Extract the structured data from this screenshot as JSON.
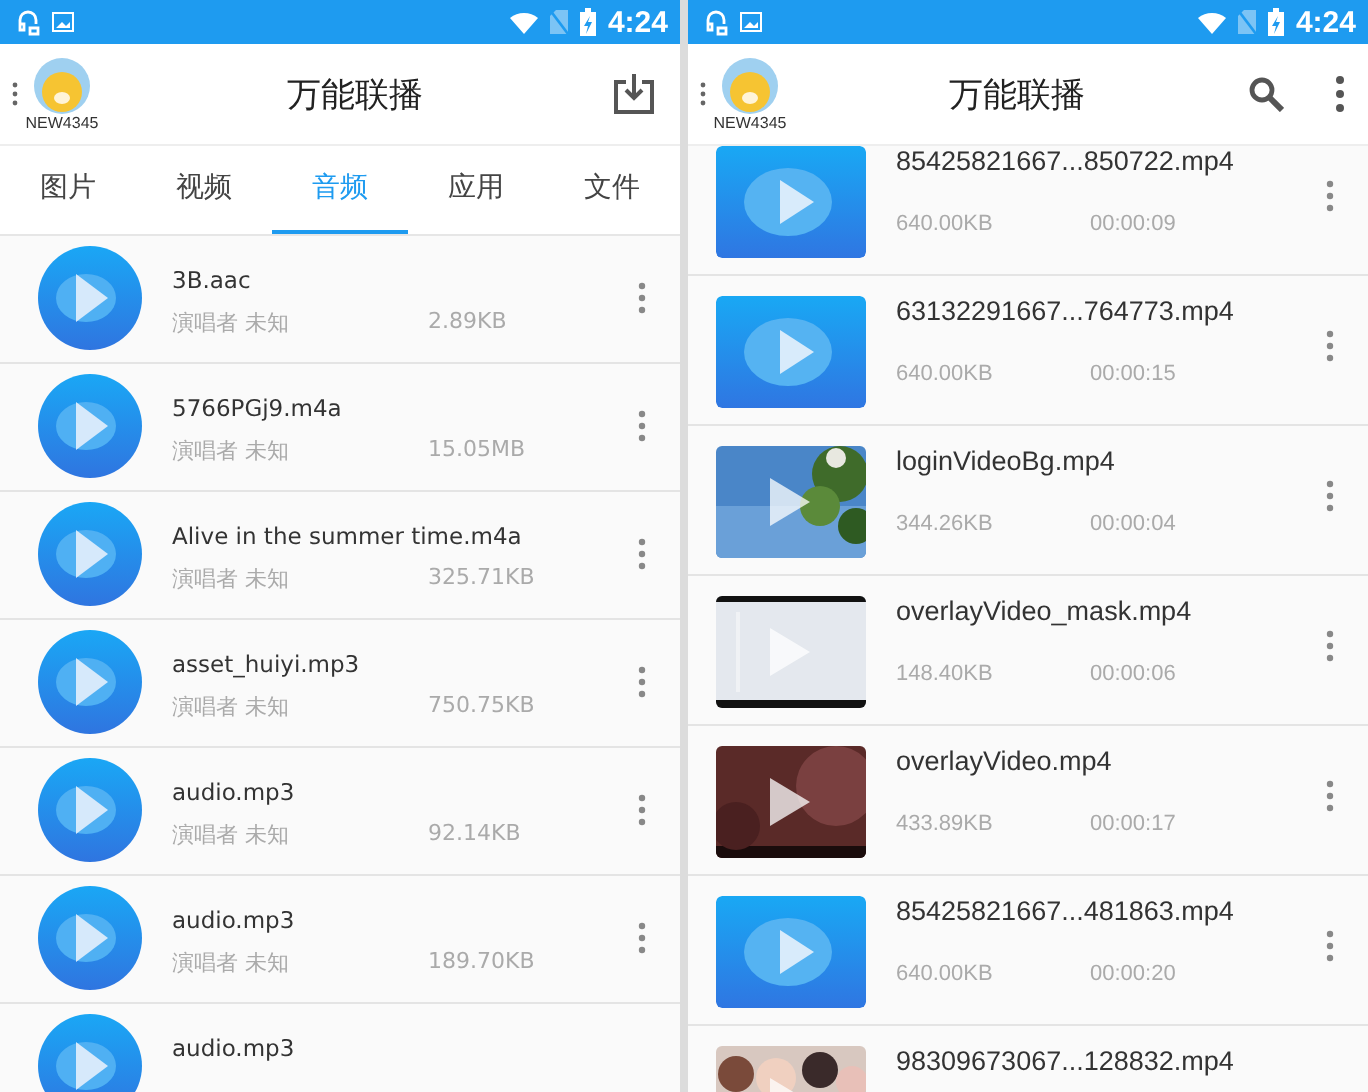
{
  "screens": [
    {
      "status_bar": {
        "time": "4:24"
      },
      "header": {
        "username": "NEW4345",
        "title": "万能联播",
        "actions": [
          {
            "kind": "download"
          }
        ]
      },
      "tabs": [
        {
          "label": "图片",
          "selected": false
        },
        {
          "label": "视频",
          "selected": false
        },
        {
          "label": "音频",
          "selected": true
        },
        {
          "label": "应用",
          "selected": false
        },
        {
          "label": "文件",
          "selected": false
        }
      ],
      "list": {
        "kind": "audio",
        "items": [
          {
            "name": "3B.aac",
            "artist": "演唱者 未知",
            "size": "2.89KB"
          },
          {
            "name": "5766PGj9.m4a",
            "artist": "演唱者 未知",
            "size": "15.05MB"
          },
          {
            "name": "Alive in the summer time.m4a",
            "artist": "演唱者 未知",
            "size": "325.71KB"
          },
          {
            "name": "asset_huiyi.mp3",
            "artist": "演唱者 未知",
            "size": "750.75KB"
          },
          {
            "name": "audio.mp3",
            "artist": "演唱者 未知",
            "size": "92.14KB"
          },
          {
            "name": "audio.mp3",
            "artist": "演唱者 未知",
            "size": "189.70KB"
          },
          {
            "name": "audio.mp3"
          }
        ]
      }
    },
    {
      "status_bar": {
        "time": "4:24"
      },
      "header": {
        "username": "NEW4345",
        "title": "万能联播",
        "actions": [
          {
            "kind": "search"
          },
          {
            "kind": "more"
          }
        ]
      },
      "list": {
        "kind": "video",
        "items": [
          {
            "name": "85425821667...850722.mp4",
            "size": "640.00KB",
            "duration": "00:00:09",
            "kind": "placeholder"
          },
          {
            "name": "63132291667...764773.mp4",
            "size": "640.00KB",
            "duration": "00:00:15",
            "kind": "placeholder"
          },
          {
            "name": "loginVideoBg.mp4",
            "size": "344.26KB",
            "duration": "00:00:04",
            "kind": "picture"
          },
          {
            "name": "overlayVideo_mask.mp4",
            "size": "148.40KB",
            "duration": "00:00:06",
            "kind": "picture"
          },
          {
            "name": "overlayVideo.mp4",
            "size": "433.89KB",
            "duration": "00:00:17",
            "kind": "picture"
          },
          {
            "name": "85425821667...481863.mp4",
            "size": "640.00KB",
            "duration": "00:00:20",
            "kind": "placeholder"
          },
          {
            "name": "98309673067...128832.mp4",
            "kind": "picture"
          }
        ]
      }
    }
  ]
}
